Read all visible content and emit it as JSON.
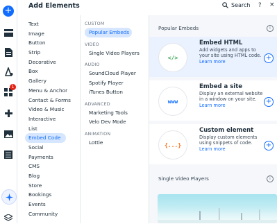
{
  "header": {
    "title": "Add Elements",
    "search_label": "Search",
    "help_label": "?",
    "close_label": "×"
  },
  "rail": {
    "add_icon": "plus-icon",
    "badge_count": "1"
  },
  "categories": [
    "Text",
    "Image",
    "Button",
    "Strip",
    "Decorative",
    "Box",
    "Gallery",
    "Menu & Anchor",
    "Contact & Forms",
    "Video & Music",
    "Interactive",
    "List",
    "Embed Code",
    "Social",
    "Payments",
    "CMS",
    "Blog",
    "Store",
    "Bookings",
    "Events",
    "Community"
  ],
  "active_category": "Embed Code",
  "subcategories": {
    "custom": {
      "title": "CUSTOM",
      "items": [
        "Popular Embeds"
      ]
    },
    "video": {
      "title": "VIDEO",
      "items": [
        "Single Video Players"
      ]
    },
    "audio": {
      "title": "AUDIO",
      "items": [
        "SoundCloud Player",
        "Spotify Player",
        "iTunes Button"
      ]
    },
    "advanced": {
      "title": "ADVANCED",
      "items": [
        "Marketing Tools",
        "Velo Dev Mode"
      ]
    },
    "animation": {
      "title": "ANIMATION",
      "items": [
        "Lottie"
      ]
    }
  },
  "active_subcategory": "Popular Embeds",
  "right": {
    "popular_title": "Popular Embeds",
    "info_label": "i",
    "cards": [
      {
        "icon_text": "</>",
        "icon_color": "#3aa655",
        "title": "Embed HTML",
        "desc": "Add widgets and apps to your site using HTML code.",
        "link": "Learn more",
        "selected": true
      },
      {
        "icon_text": "www",
        "icon_color": "#116dff",
        "title": "Embed a site",
        "desc": "Display an external website in a window on your site.",
        "link": "Learn more",
        "selected": false
      },
      {
        "icon_text": "{...}",
        "icon_color": "#ff6a13",
        "title": "Custom element",
        "desc": "Display custom elements using snippets of code.",
        "link": "Learn more",
        "selected": false
      }
    ],
    "video_title": "Single Video Players",
    "add_label": "+"
  },
  "colors": {
    "accent": "#116dff",
    "active_bg": "#d6e6fe",
    "badge": "#e62214"
  }
}
